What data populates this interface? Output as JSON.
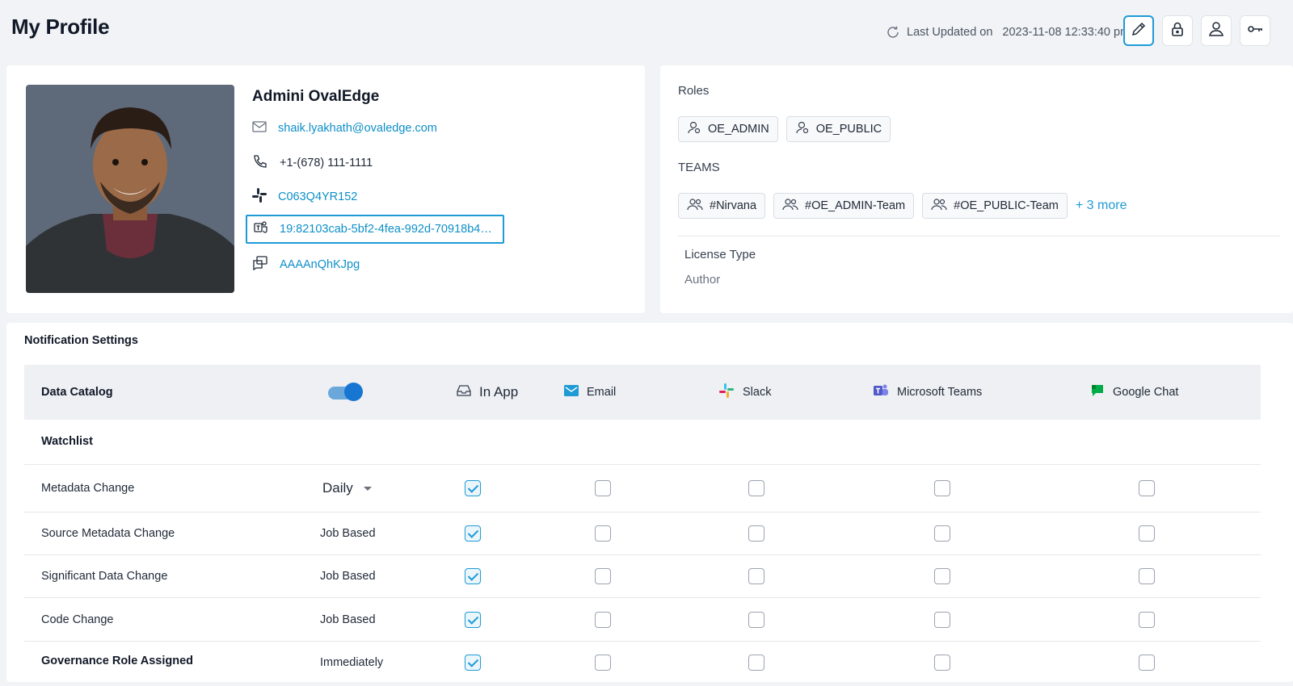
{
  "header": {
    "title": "My Profile",
    "last_updated_label": "Last Updated on",
    "last_updated_value": "2023-11-08 12:33:40 pm",
    "actions": [
      "edit-icon",
      "lock-icon",
      "user-icon",
      "key-icon"
    ]
  },
  "profile": {
    "name": "Admini OvalEdge",
    "email": "shaik.lyakhath@ovaledge.com",
    "phone": "+1-(678) 111-1111",
    "slack_id": "C063Q4YR152",
    "teams_id": "19:82103cab-5bf2-4fea-992d-70918b4a8...",
    "chat_id": "AAAAnQhKJpg"
  },
  "roles": {
    "label": "Roles",
    "items": [
      "OE_ADMIN",
      "OE_PUBLIC"
    ]
  },
  "teams": {
    "label": "TEAMS",
    "items": [
      "#Nirvana",
      "#OE_ADMIN-Team",
      "#OE_PUBLIC-Team"
    ],
    "more": "+ 3 more"
  },
  "license": {
    "label": "License Type",
    "value": "Author"
  },
  "notifications": {
    "title": "Notification Settings",
    "module": "Data Catalog",
    "toggle_on": true,
    "channels": [
      "In App",
      "Email",
      "Slack",
      "Microsoft Teams",
      "Google Chat"
    ],
    "section": "Watchlist",
    "rows": [
      {
        "name": "Metadata Change",
        "frequency": "Daily",
        "dropdown": true,
        "checks": [
          true,
          false,
          false,
          false,
          false
        ]
      },
      {
        "name": "Source Metadata Change",
        "frequency": "Job Based",
        "dropdown": false,
        "checks": [
          true,
          false,
          false,
          false,
          false
        ]
      },
      {
        "name": "Significant Data Change",
        "frequency": "Job Based",
        "dropdown": false,
        "checks": [
          true,
          false,
          false,
          false,
          false
        ]
      },
      {
        "name": "Code Change",
        "frequency": "Job Based",
        "dropdown": false,
        "checks": [
          true,
          false,
          false,
          false,
          false
        ]
      },
      {
        "name": "Governance Role Assigned",
        "frequency": "Immediately",
        "dropdown": false,
        "checks": [
          true,
          false,
          false,
          false,
          false
        ]
      }
    ]
  },
  "colors": {
    "accent": "#1e9ad6",
    "background": "#f1f3f6",
    "toggle": "#1676d2"
  }
}
